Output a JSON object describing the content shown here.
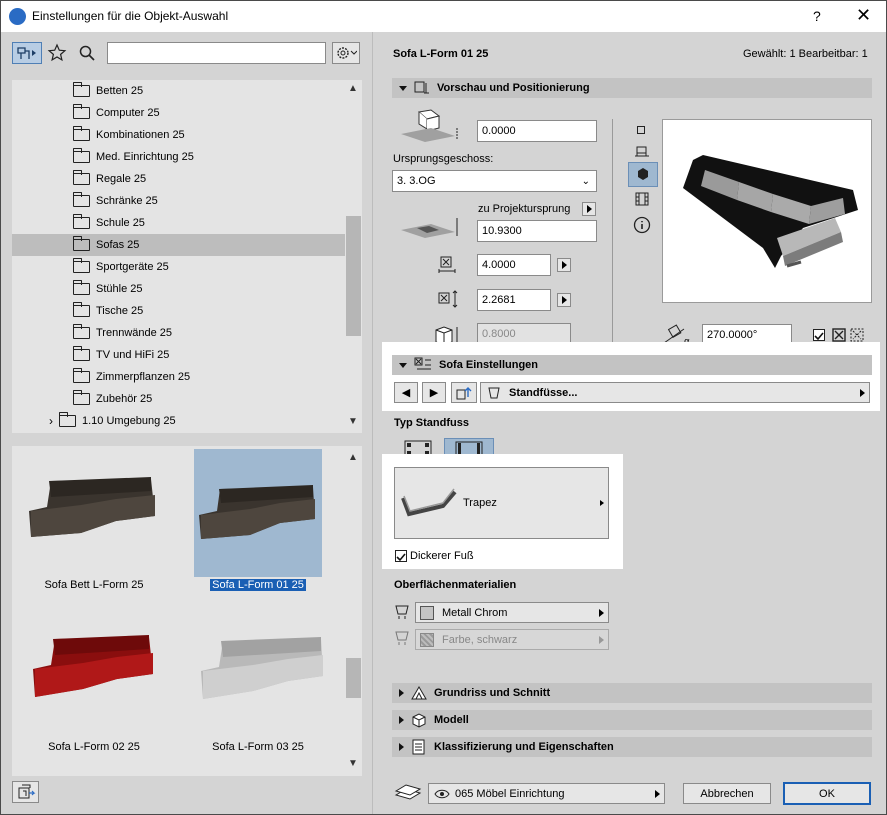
{
  "window": {
    "title": "Einstellungen für die Objekt-Auswahl",
    "help": "?",
    "close": "✕"
  },
  "search": {
    "value": "",
    "placeholder": ""
  },
  "tree": {
    "items": [
      {
        "label": "Betten 25"
      },
      {
        "label": "Computer 25"
      },
      {
        "label": "Kombinationen 25"
      },
      {
        "label": "Med. Einrichtung 25"
      },
      {
        "label": "Regale 25"
      },
      {
        "label": "Schränke 25"
      },
      {
        "label": "Schule 25"
      },
      {
        "label": "Sofas 25",
        "selected": true
      },
      {
        "label": "Sportgeräte 25"
      },
      {
        "label": "Stühle 25"
      },
      {
        "label": "Tische 25"
      },
      {
        "label": "Trennwände 25"
      },
      {
        "label": "TV und HiFi 25"
      },
      {
        "label": "Zimmerpflanzen 25"
      },
      {
        "label": "Zubehör 25"
      }
    ],
    "parent_item": "1.10 Umgebung 25"
  },
  "thumbnails": [
    {
      "label": "Sofa Bett L-Form 25",
      "color": "#3a342e"
    },
    {
      "label": "Sofa L-Form 01 25",
      "color": "#3a342e",
      "selected": true
    },
    {
      "label": "Sofa L-Form 02 25",
      "color": "#9a1212"
    },
    {
      "label": "Sofa L-Form 03 25",
      "color": "#b9b9b9"
    }
  ],
  "header": {
    "object_name": "Sofa L-Form 01 25",
    "status": "Gewählt: 1 Bearbeitbar: 1"
  },
  "preview": {
    "section_title": "Vorschau und Positionierung",
    "offset_value": "0.0000",
    "story_label": "Ursprungsgeschoss:",
    "story_value": "3. 3.OG",
    "project_origin_label": "zu Projektursprung",
    "project_origin_value": "10.9300",
    "width_value": "4.0000",
    "depth_value": "2.2681",
    "height_value": "0.8000",
    "angle_value": "270.0000°"
  },
  "sofa_settings": {
    "section_title": "Sofa Einstellungen",
    "page_value": "Standfüsse...",
    "foot_type_label": "Typ Standfuss",
    "foot_style_value": "Trapez",
    "thicker_foot_label": "Dickerer Fuß",
    "thicker_foot_checked": true,
    "materials_label": "Oberflächenmaterialien",
    "material_1": "Metall Chrom",
    "material_2": "Farbe, schwarz"
  },
  "sections": {
    "floor_plan": "Grundriss und Schnitt",
    "model": "Modell",
    "classification": "Klassifizierung und Eigenschaften"
  },
  "footer": {
    "layer_value": "065 Möbel Einrichtung",
    "cancel": "Abbrechen",
    "ok": "OK"
  },
  "colors": {
    "selection": "#1a5fb4",
    "thumb_highlight": "#9fb8d0",
    "panel": "#d4d4d4"
  }
}
